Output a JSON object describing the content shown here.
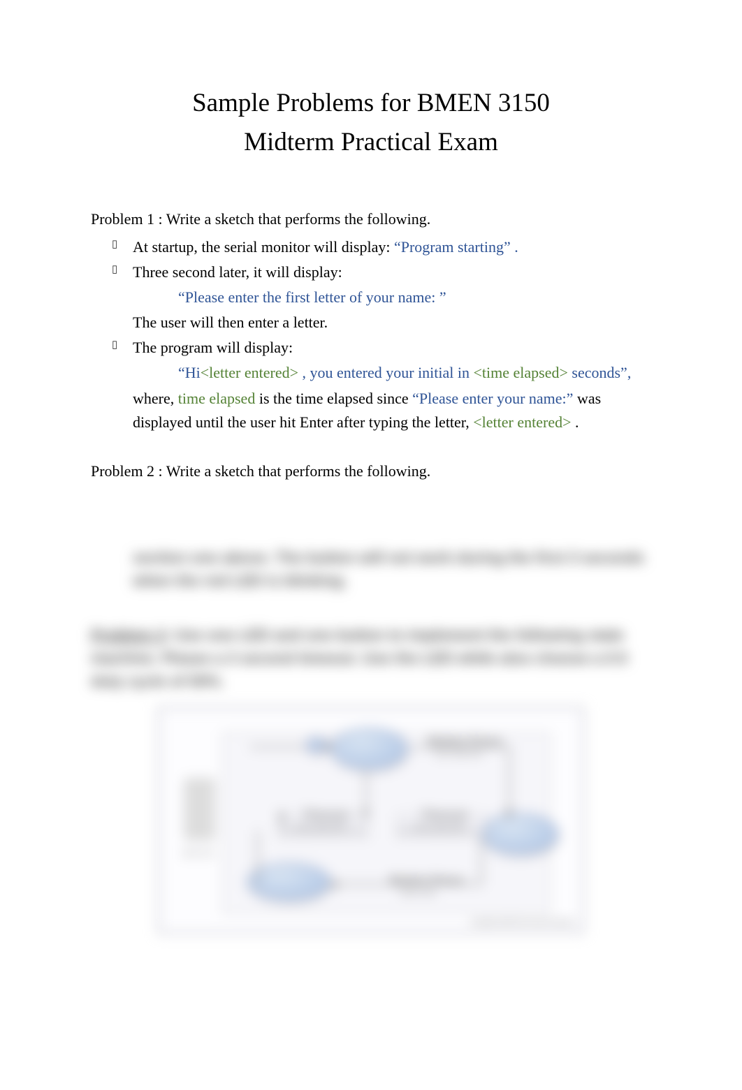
{
  "title": {
    "line1": "Sample Problems for BMEN 3150",
    "line2": "Midterm Practical Exam"
  },
  "problem1": {
    "heading": "Problem 1 : Write a sketch that performs the following.",
    "bullet1_pre": "At startup, the serial monitor will display: ",
    "bullet1_blue": "“Program starting” .",
    "bullet2": "Three second later, it will display:",
    "bullet2_sub_blue": "“Please enter the first letter of your name:   ”",
    "bullet2_followup": "The user will then enter a letter.",
    "bullet3": "The program will display:",
    "bullet3_sub_open": "“Hi",
    "bullet3_sub_green1": "<letter entered> ",
    "bullet3_sub_mid": ", you entered your initial in ",
    "bullet3_sub_green2": "<time elapsed> ",
    "bullet3_sub_end": "seconds”,",
    "where_pre": "where, ",
    "where_green": "time elapsed ",
    "where_mid": " is the time elapsed since ",
    "where_blue": "“Please enter your name:” ",
    "where_post": " was displayed until the user hit Enter after typing the letter,  ",
    "where_green2": "<letter entered> ",
    "where_period": "."
  },
  "problem2": {
    "heading": "Problem 2 : Write a sketch that performs the following."
  }
}
